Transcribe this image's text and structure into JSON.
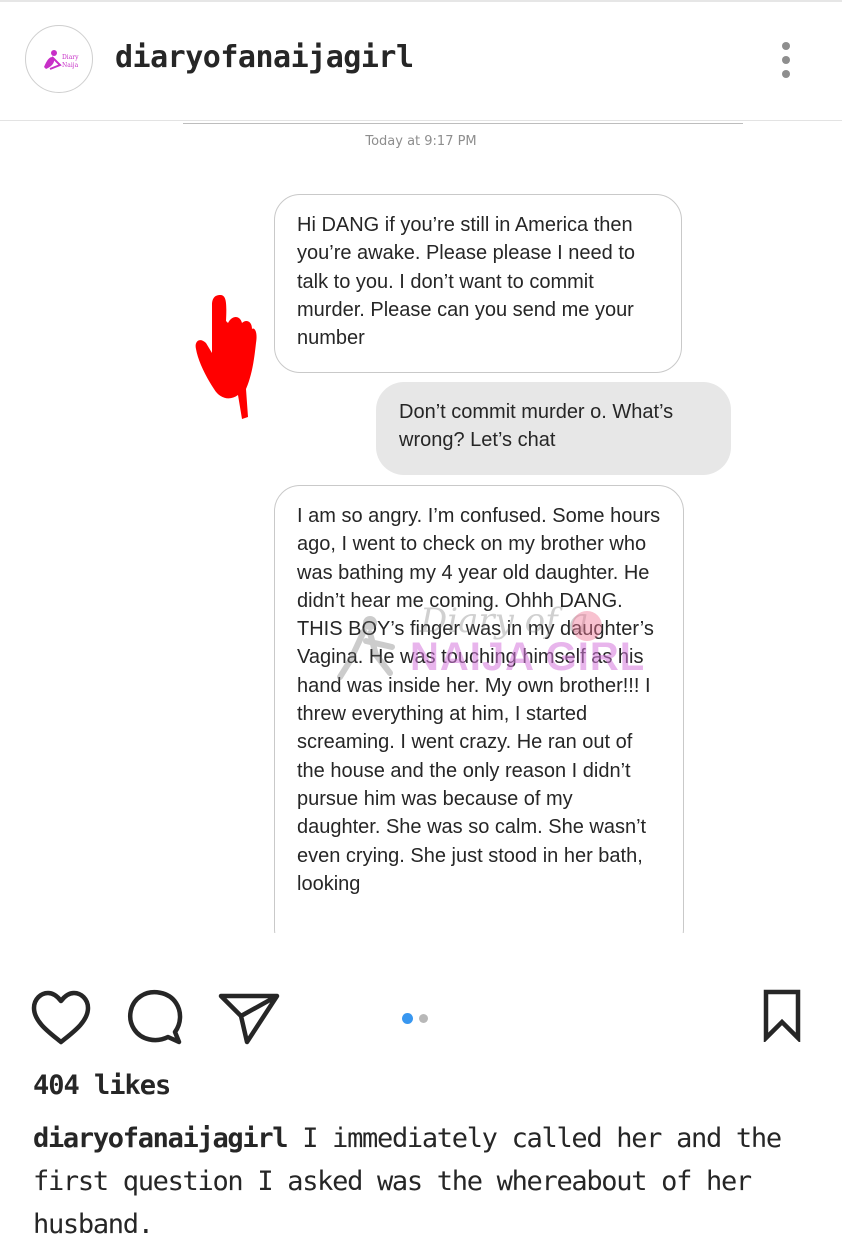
{
  "header": {
    "username": "diaryofanaijagirl",
    "avatar_icon": "brand-logo-icon",
    "more_icon": "more-options-icon"
  },
  "post": {
    "timestamp": "Today at 9:17 PM",
    "messages": [
      {
        "side": "incoming",
        "text": "Hi DANG if you’re still in America then you’re awake. Please please I need to talk to you. I don’t want to commit murder. Please can you send me your number"
      },
      {
        "side": "outgoing",
        "text": "Don’t commit murder o. What’s wrong? Let’s chat"
      },
      {
        "side": "incoming",
        "text": "I am so angry. I’m confused. Some hours ago, I went to check on my brother who was bathing my 4 year old daughter. He didn’t hear me coming. Ohhh DANG. THIS BOY’s finger was in my daughter’s Vagina. He was  touching himself as his hand was inside her. My own brother!!! I threw everything at him, I started screaming. I went crazy. He ran out of the house and the only reason I didn’t pursue him was because of my daughter. She was so calm. She wasn’t even crying. She just stood in her bath, looking"
      }
    ],
    "watermark": {
      "script": "Diary of a",
      "big": "NAIJA GIRL"
    },
    "pointer_icon": "red-pointing-hand-icon",
    "pointer_color": "#ff0000"
  },
  "actions": {
    "like_icon": "heart-icon",
    "comment_icon": "comment-icon",
    "share_icon": "send-icon",
    "save_icon": "bookmark-icon",
    "carousel": {
      "total": 2,
      "current": 1
    },
    "accent_color": "#3897f0"
  },
  "likes": "404 likes",
  "caption": {
    "username": "diaryofanaijagirl",
    "text": " I immediately called her and the first question I asked was the whereabout of her husband."
  }
}
